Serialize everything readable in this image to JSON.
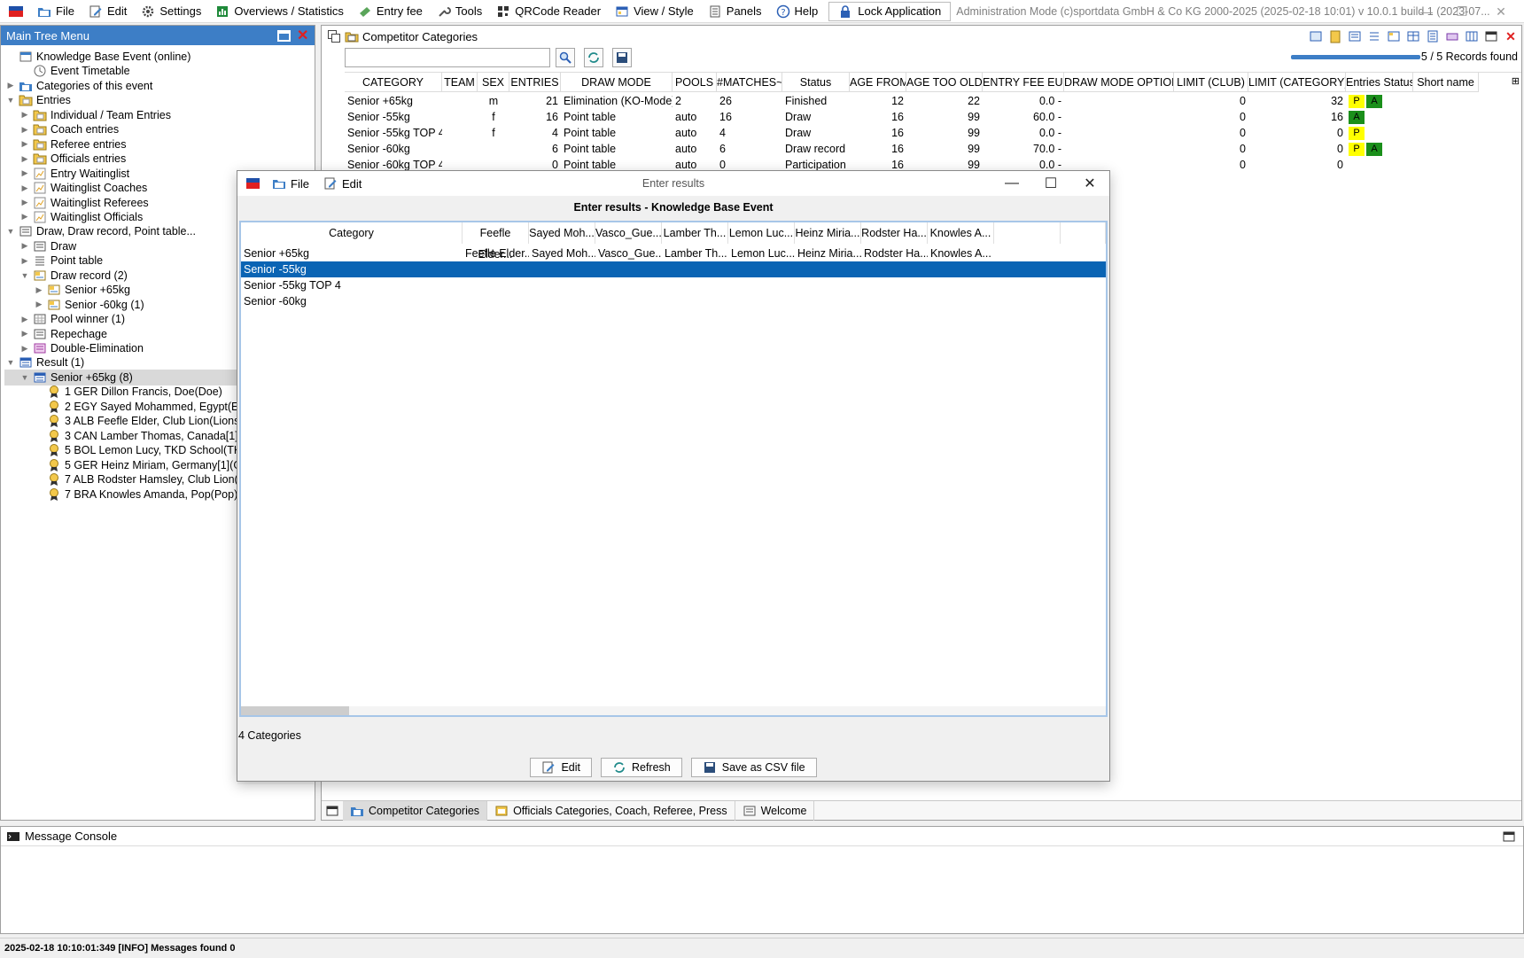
{
  "menubar": {
    "items": [
      {
        "label": "File",
        "icon": "folder-icon"
      },
      {
        "label": "Edit",
        "icon": "edit-icon"
      },
      {
        "label": "Settings",
        "icon": "gear-icon"
      },
      {
        "label": "Overviews / Statistics",
        "icon": "chart-icon"
      },
      {
        "label": "Entry fee",
        "icon": "money-icon"
      },
      {
        "label": "Tools",
        "icon": "wrench-icon"
      },
      {
        "label": "QRCode Reader",
        "icon": "qrcode-icon"
      },
      {
        "label": "View / Style",
        "icon": "layout-icon"
      },
      {
        "label": "Panels",
        "icon": "panels-icon"
      },
      {
        "label": "Help",
        "icon": "help-icon"
      }
    ],
    "lock_label": "Lock Application",
    "admin_info": "Administration Mode (c)sportdata GmbH & Co KG 2000-2025 (2025-02-18 10:01)  v 10.0.1 build 1 (2023-07..."
  },
  "tree": {
    "title": "Main Tree Menu",
    "rows": [
      {
        "label": "Knowledge Base Event (online)",
        "level": 0,
        "toggle": "",
        "icon": "event-icon"
      },
      {
        "label": "Event Timetable",
        "level": 1,
        "toggle": "",
        "icon": "clock-icon"
      },
      {
        "label": "Categories of this event",
        "level": 0,
        "toggle": "▶",
        "icon": "categories-icon"
      },
      {
        "label": "Entries",
        "level": 0,
        "toggle": "▼",
        "icon": "entries-icon"
      },
      {
        "label": "Individual / Team Entries",
        "level": 1,
        "toggle": "▶",
        "icon": "entries-icon"
      },
      {
        "label": "Coach entries",
        "level": 1,
        "toggle": "▶",
        "icon": "entries-icon"
      },
      {
        "label": "Referee entries",
        "level": 1,
        "toggle": "▶",
        "icon": "entries-icon"
      },
      {
        "label": "Officials entries",
        "level": 1,
        "toggle": "▶",
        "icon": "entries-icon"
      },
      {
        "label": "Entry Waitinglist",
        "level": 1,
        "toggle": "▶",
        "icon": "waitinglist-icon"
      },
      {
        "label": "Waitinglist Coaches",
        "level": 1,
        "toggle": "▶",
        "icon": "waitinglist-icon"
      },
      {
        "label": "Waitinglist Referees",
        "level": 1,
        "toggle": "▶",
        "icon": "waitinglist-icon"
      },
      {
        "label": "Waitinglist Officials",
        "level": 1,
        "toggle": "▶",
        "icon": "waitinglist-icon"
      },
      {
        "label": "Draw, Draw record, Point table...",
        "level": 0,
        "toggle": "▼",
        "icon": "draw-icon"
      },
      {
        "label": "Draw",
        "level": 1,
        "toggle": "▶",
        "icon": "draw-icon"
      },
      {
        "label": "Point table",
        "level": 1,
        "toggle": "▶",
        "icon": "list-icon"
      },
      {
        "label": "Draw record (2)",
        "level": 1,
        "toggle": "▼",
        "icon": "record-icon"
      },
      {
        "label": "Senior +65kg",
        "level": 2,
        "toggle": "▶",
        "icon": "record-icon"
      },
      {
        "label": "Senior -60kg (1)",
        "level": 2,
        "toggle": "▶",
        "icon": "record-icon"
      },
      {
        "label": "Pool winner (1)",
        "level": 1,
        "toggle": "▶",
        "icon": "pool-icon"
      },
      {
        "label": "Repechage",
        "level": 1,
        "toggle": "▶",
        "icon": "draw-icon"
      },
      {
        "label": "Double-Elimination",
        "level": 1,
        "toggle": "▶",
        "icon": "double-elim-icon"
      },
      {
        "label": "Result (1)",
        "level": 0,
        "toggle": "▼",
        "icon": "result-icon"
      },
      {
        "label": "Senior +65kg (8)",
        "level": 1,
        "toggle": "▼",
        "icon": "result-icon",
        "selected": true
      },
      {
        "label": "1 GER Dillon Francis, Doe(Doe)",
        "level": 2,
        "toggle": "",
        "icon": "medal-icon"
      },
      {
        "label": "2 EGY Sayed Mohammed, Egypt(EG",
        "level": 2,
        "toggle": "",
        "icon": "medal-icon"
      },
      {
        "label": "3 ALB Feefle Elder, Club Lion(Lions)",
        "level": 2,
        "toggle": "",
        "icon": "medal-icon"
      },
      {
        "label": "3 CAN Lamber Thomas, Canada[1](",
        "level": 2,
        "toggle": "",
        "icon": "medal-icon"
      },
      {
        "label": "5 BOL Lemon Lucy, TKD School(TKD",
        "level": 2,
        "toggle": "",
        "icon": "medal-icon"
      },
      {
        "label": "5 GER Heinz Miriam, Germany[1](GE",
        "level": 2,
        "toggle": "",
        "icon": "medal-icon"
      },
      {
        "label": "7 ALB Rodster Hamsley, Club Lion(L",
        "level": 2,
        "toggle": "",
        "icon": "medal-icon"
      },
      {
        "label": "7 BRA Knowles Amanda, Pop(Pop)",
        "level": 2,
        "toggle": "",
        "icon": "medal-icon"
      }
    ]
  },
  "main": {
    "title": "Competitor Categories",
    "records_found": "5 / 5 Records found",
    "columns": [
      "CATEGORY",
      "TEAM",
      "SEX",
      "ENTRIES",
      "DRAW MODE",
      "POOLS",
      "#MATCHES~",
      "Status",
      "AGE FROM",
      "AGE TOO OLD",
      "ENTRY FEE EUR",
      "DRAW MODE OPTION",
      "LIMIT (CLUB)",
      "LIMIT (CATEGORY)",
      "Entries Status",
      "Short name"
    ],
    "rows": [
      {
        "category": "Senior +65kg",
        "team": "",
        "sex": "m",
        "entries": "21",
        "draw_mode": "Elimination (KO-Mode)",
        "pools": "2",
        "matches": "26",
        "status": "Finished",
        "age_from": "12",
        "age_too_old": "22",
        "fee": "0.0 -",
        "option": "",
        "limit_club": "0",
        "limit_cat": "32",
        "badges": [
          "P",
          "A"
        ]
      },
      {
        "category": "Senior -55kg",
        "team": "",
        "sex": "f",
        "entries": "16",
        "draw_mode": "Point table",
        "pools": "auto",
        "matches": "16",
        "status": "Draw",
        "age_from": "16",
        "age_too_old": "99",
        "fee": "60.0 -",
        "option": "",
        "limit_club": "0",
        "limit_cat": "16",
        "badges": [
          "A"
        ]
      },
      {
        "category": "Senior -55kg TOP 4",
        "team": "",
        "sex": "f",
        "entries": "4",
        "draw_mode": "Point table",
        "pools": "auto",
        "matches": "4",
        "status": "Draw",
        "age_from": "16",
        "age_too_old": "99",
        "fee": "0.0 -",
        "option": "",
        "limit_club": "0",
        "limit_cat": "0",
        "badges": [
          "P"
        ]
      },
      {
        "category": "Senior -60kg",
        "team": "",
        "sex": "",
        "entries": "6",
        "draw_mode": "Point table",
        "pools": "auto",
        "matches": "6",
        "status": "Draw record",
        "age_from": "16",
        "age_too_old": "99",
        "fee": "70.0 -",
        "option": "",
        "limit_club": "0",
        "limit_cat": "0",
        "badges": [
          "P",
          "A"
        ]
      },
      {
        "category": "Senior -60kg TOP 4",
        "team": "",
        "sex": "",
        "entries": "0",
        "draw_mode": "Point table",
        "pools": "auto",
        "matches": "0",
        "status": "Participation",
        "age_from": "16",
        "age_too_old": "99",
        "fee": "0.0 -",
        "option": "",
        "limit_club": "0",
        "limit_cat": "0",
        "badges": []
      }
    ],
    "tabs": [
      {
        "label": "Competitor Categories",
        "active": true,
        "icon": "categories-icon"
      },
      {
        "label": "Officials Categories, Coach, Referee, Press",
        "active": false,
        "icon": "officials-icon"
      },
      {
        "label": "Welcome",
        "active": false,
        "icon": "welcome-icon"
      }
    ]
  },
  "dialog": {
    "window_title": "Enter results",
    "menu": [
      {
        "label": "File",
        "icon": "folder-icon"
      },
      {
        "label": "Edit",
        "icon": "edit-icon"
      }
    ],
    "heading": "Enter results - Knowledge Base Event",
    "columns": [
      "Category",
      "Feefle Elder...",
      "Sayed Moh...",
      "Vasco_Gue...",
      "Lamber Th...",
      "Lemon Luc...",
      "Heinz Miria...",
      "Rodster Ha...",
      "Knowles A...",
      "",
      ""
    ],
    "rows": [
      {
        "category": "Senior +65kg",
        "selected": false
      },
      {
        "category": "Senior -55kg",
        "selected": true
      },
      {
        "category": "Senior -55kg TOP 4",
        "selected": false
      },
      {
        "category": "Senior -60kg",
        "selected": false
      }
    ],
    "row0_values": [
      "Feefle Elder...",
      "Sayed Moh...",
      "Vasco_Gue...",
      "Lamber Th...",
      "Lemon Luc...",
      "Heinz Miria...",
      "Rodster Ha...",
      "Knowles A...",
      "",
      ""
    ],
    "count_label": "4 Categories",
    "buttons": {
      "edit": "Edit",
      "refresh": "Refresh",
      "csv": "Save as CSV file"
    }
  },
  "console": {
    "title": "Message Console",
    "status_line": "2025-02-18 10:10:01:349 [INFO] Messages found 0"
  }
}
